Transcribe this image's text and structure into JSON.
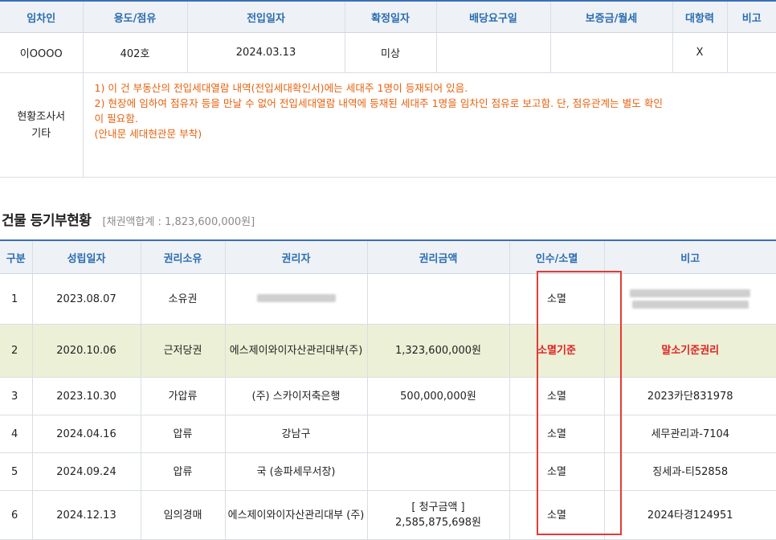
{
  "tenant_table": {
    "headers": [
      "임차인",
      "용도/점유",
      "전입일자",
      "확정일자",
      "배당요구일",
      "보증금/월세",
      "대항력",
      "비고"
    ],
    "row": {
      "tenant": "이OOOO",
      "use": "402호",
      "move_in_date": "2024.03.13",
      "fixed_date": "미상",
      "dividend_request_date": "",
      "deposit_rent": "",
      "opposing_power": "X",
      "note": ""
    },
    "survey": {
      "label_line1": "현황조사서",
      "label_line2": "기타",
      "lines": [
        "1) 이 건 부동산의 전입세대열람 내역(전입세대확인서)에는 세대주 1명이 등재되어 있음.",
        "2) 현장에 임하여 점유자 등을 만날 수 없어 전입세대열람 내역에 등재된 세대주 1명을 임차인 점유로 보고함. 단, 점유관계는 별도 확인",
        "이 필요함.",
        "(안내문 세대현관문 부착)"
      ]
    }
  },
  "registry_section": {
    "title": "건물 등기부현황",
    "summary": "[채권액합계 : 1,823,600,000원]"
  },
  "registry_table": {
    "headers": [
      "구분",
      "성립일자",
      "권리소유",
      "권리자",
      "권리금액",
      "인수/소멸",
      "비고"
    ],
    "rows": [
      {
        "num": "1",
        "date": "2023.08.07",
        "right": "소유권",
        "holder": "",
        "amount": "",
        "status": "소멸",
        "note": "",
        "holder_redacted": true,
        "note_redacted": true
      },
      {
        "num": "2",
        "date": "2020.10.06",
        "right": "근저당권",
        "holder": "에스제이와이자산관리대부(주)",
        "amount": "1,323,600,000원",
        "status": "소멸기준",
        "note": "말소기준권리",
        "highlight": true
      },
      {
        "num": "3",
        "date": "2023.10.30",
        "right": "가압류",
        "holder": "(주) 스카이저축은행",
        "amount": "500,000,000원",
        "status": "소멸",
        "note": "2023카단831978"
      },
      {
        "num": "4",
        "date": "2024.04.16",
        "right": "압류",
        "holder": "강남구",
        "amount": "",
        "status": "소멸",
        "note": "세무관리과-7104"
      },
      {
        "num": "5",
        "date": "2024.09.24",
        "right": "압류",
        "holder": "국 (송파세무서장)",
        "amount": "",
        "status": "소멸",
        "note": "징세과-티52858"
      },
      {
        "num": "6",
        "date": "2024.12.13",
        "right": "임의경매",
        "holder": "에스제이와이자산관리대부 (주)",
        "amount": "[ 청구금액 ]",
        "amount_line2": "2,585,875,698원",
        "status": "소멸",
        "note": "2024타경124951"
      }
    ]
  },
  "colors": {
    "header_text": "#2b6cb0",
    "header_bg": "#eef2f6",
    "orange_text": "#e8620e",
    "red_text": "#e02020",
    "highlight_row": "#ecf0d6",
    "red_box": "#e53935"
  }
}
